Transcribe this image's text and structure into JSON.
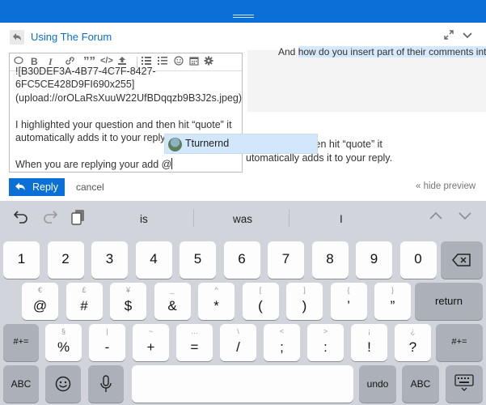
{
  "composer": {
    "topic_title": "Using The Forum",
    "editor_lines": [
      "![B30DEF3A-4B77-4C7F-8427-",
      "6FC5CE428D9FI690x255]",
      "(upload://orOLaRsXuuW22UfBDqqzb9B3J2s.jpeg)",
      "",
      "I highlighted your question and then hit “quote” it",
      "automatically adds it to your reply.",
      "",
      "When you are replying your add @"
    ],
    "toolbar_icons": [
      "speech-bubble-icon",
      "bold-icon",
      "italic-icon",
      "link-icon",
      "quote-icon",
      "code-icon",
      "upload-icon",
      "bullet-list-icon",
      "numbered-list-icon",
      "emoji-icon",
      "calendar-icon",
      "gear-icon"
    ],
    "mention_suggestion": "Tturnernd",
    "preview": {
      "line1_plain": "And ",
      "line1_highlight": "how do you insert part of their comments into yo",
      "para_line1": "question and then hit “quote” it",
      "para_line2": "utomatically adds it to your reply."
    },
    "reply_label": "Reply",
    "cancel_label": "cancel",
    "hide_preview_label": "« hide preview"
  },
  "keyboard": {
    "suggestions": [
      "is",
      "was",
      "I"
    ],
    "row1": [
      {
        "main": "1"
      },
      {
        "main": "2"
      },
      {
        "main": "3"
      },
      {
        "main": "4"
      },
      {
        "main": "5"
      },
      {
        "main": "6"
      },
      {
        "main": "7"
      },
      {
        "main": "8"
      },
      {
        "main": "9"
      },
      {
        "main": "0"
      }
    ],
    "row2": [
      {
        "alt": "€",
        "main": "@"
      },
      {
        "alt": "£",
        "main": "#"
      },
      {
        "alt": "¥",
        "main": "$"
      },
      {
        "alt": "_",
        "main": "&"
      },
      {
        "alt": "^",
        "main": "*"
      },
      {
        "alt": "[",
        "main": "("
      },
      {
        "alt": "]",
        "main": ")"
      },
      {
        "alt": "{",
        "main": "’"
      },
      {
        "alt": "}",
        "main": "”"
      }
    ],
    "return_label": "return",
    "row3": [
      {
        "alt": "§",
        "main": "%"
      },
      {
        "alt": "|",
        "main": "-"
      },
      {
        "alt": "~",
        "main": "+"
      },
      {
        "alt": "…",
        "main": "="
      },
      {
        "alt": "\\",
        "main": "/"
      },
      {
        "alt": "<",
        "main": ";"
      },
      {
        "alt": ">",
        "main": ":"
      },
      {
        "alt": "¡",
        "main": "!"
      },
      {
        "alt": "¿",
        "main": "?"
      }
    ],
    "shift_label": "#+=",
    "abc_label": "ABC",
    "undo_label": "undo"
  }
}
